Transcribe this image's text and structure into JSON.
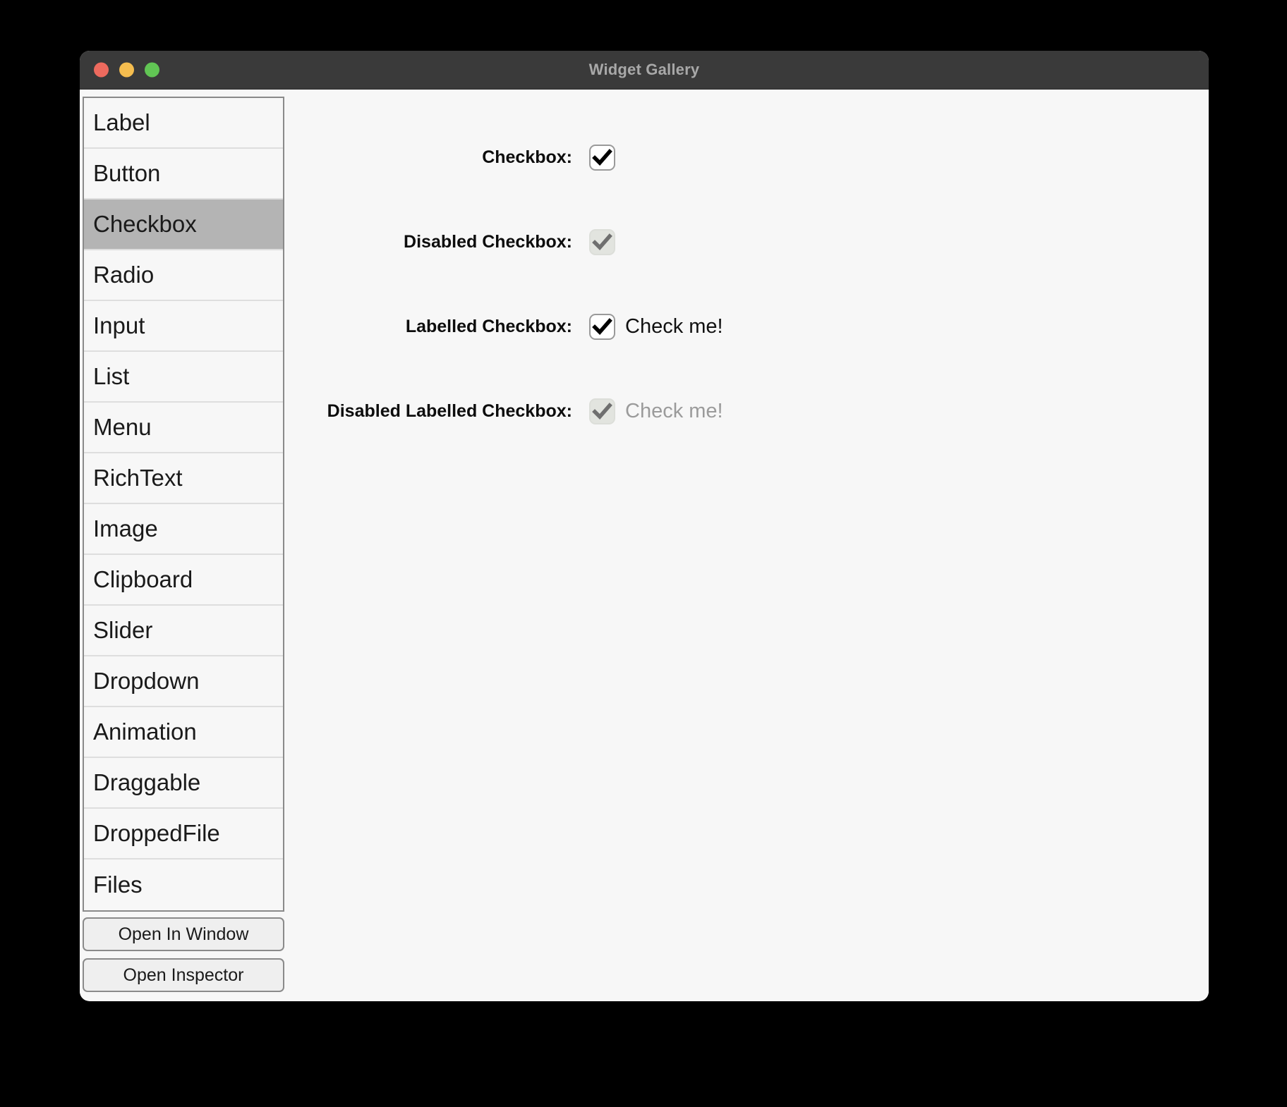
{
  "window": {
    "title": "Widget Gallery",
    "traffic_lights": [
      {
        "name": "close",
        "color": "#ed6a5e"
      },
      {
        "name": "minimize",
        "color": "#f5bd4f"
      },
      {
        "name": "zoom",
        "color": "#61c554"
      }
    ]
  },
  "sidebar": {
    "items": [
      {
        "label": "Label",
        "selected": false
      },
      {
        "label": "Button",
        "selected": false
      },
      {
        "label": "Checkbox",
        "selected": true
      },
      {
        "label": "Radio",
        "selected": false
      },
      {
        "label": "Input",
        "selected": false
      },
      {
        "label": "List",
        "selected": false
      },
      {
        "label": "Menu",
        "selected": false
      },
      {
        "label": "RichText",
        "selected": false
      },
      {
        "label": "Image",
        "selected": false
      },
      {
        "label": "Clipboard",
        "selected": false
      },
      {
        "label": "Slider",
        "selected": false
      },
      {
        "label": "Dropdown",
        "selected": false
      },
      {
        "label": "Animation",
        "selected": false
      },
      {
        "label": "Draggable",
        "selected": false
      },
      {
        "label": "DroppedFile",
        "selected": false
      },
      {
        "label": "Files",
        "selected": false
      }
    ],
    "buttons": [
      {
        "label": "Open In Window"
      },
      {
        "label": "Open Inspector"
      }
    ]
  },
  "main": {
    "rows": [
      {
        "label": "Checkbox:",
        "checked": true,
        "disabled": false,
        "text": ""
      },
      {
        "label": "Disabled Checkbox:",
        "checked": true,
        "disabled": true,
        "text": ""
      },
      {
        "label": "Labelled Checkbox:",
        "checked": true,
        "disabled": false,
        "text": "Check me!"
      },
      {
        "label": "Disabled Labelled Checkbox:",
        "checked": true,
        "disabled": true,
        "text": "Check me!"
      }
    ]
  },
  "colors": {
    "titlebar": "#3a3a3a",
    "title_text": "#a8a8a8",
    "background": "#f7f7f7",
    "selected_item": "#b4b4b4",
    "border": "#8a8a8a",
    "checkmark": "#000000",
    "checkmark_disabled": "#6f6f6f",
    "disabled_text": "#9b9b9b"
  }
}
